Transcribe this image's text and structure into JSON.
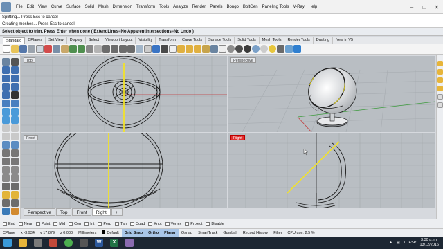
{
  "menu": [
    "File",
    "Edit",
    "View",
    "Curve",
    "Surface",
    "Solid",
    "Mesh",
    "Dimension",
    "Transform",
    "Tools",
    "Analyze",
    "Render",
    "Panels",
    "Bongo",
    "BoltGen",
    "Paneling Tools",
    "V-Ray",
    "Help"
  ],
  "command_history": [
    "Splitting... Press Esc to cancel",
    "Creating meshes... Press Esc to cancel"
  ],
  "command_prompt": "Select object to trim. Press Enter when done ( ExtendLines=No  ApparentIntersections=No  Undo )",
  "toolbar_tabs": [
    "Standard",
    "CPlanes",
    "Set View",
    "Display",
    "Select",
    "Viewport Layout",
    "Visibility",
    "Transform",
    "Curve Tools",
    "Surface Tools",
    "Solid Tools",
    "Mesh Tools",
    "Render Tools",
    "Drafting",
    "New in V5"
  ],
  "viewports": {
    "top": "Top",
    "perspective": "Perspective",
    "front": "Front",
    "right": "Right",
    "axis_x": "x",
    "axis_y": "y",
    "axis_z": "z"
  },
  "viewport_tabs": [
    "Perspective",
    "Top",
    "Front",
    "Right"
  ],
  "osnaps": [
    "End",
    "Near",
    "Point",
    "Mid",
    "Cen",
    "Int",
    "Perp",
    "Tan",
    "Quad",
    "Knot",
    "Vertex",
    "Project",
    "Disable"
  ],
  "status": {
    "cplane": "CPlane",
    "x": "x -3.934",
    "y": "y 17.879",
    "z": "z 0.000",
    "units": "Millimeters",
    "layer": "Default",
    "grid_snap": "Grid Snap",
    "ortho": "Ortho",
    "planar": "Planar",
    "osnap": "Osnap",
    "smarttrack": "SmartTrack",
    "gumball": "Gumball",
    "record_history": "Record History",
    "filter": "Filter",
    "cpu": "CPU use: 2.5 %"
  },
  "taskbar": {
    "lang": "ESP",
    "time": "3:30 p. m.",
    "date": "13/12/2016",
    "word_label": "W",
    "excel_label": "X"
  },
  "colors": {
    "viewport_bg": "#b9bec3",
    "grid": "#a4a9ae",
    "curve": "#1a1a1a",
    "selected": "#f1e22a",
    "axis_red": "#c23a3a",
    "axis_green": "#3c9a3c",
    "active_label": "#e23030"
  }
}
